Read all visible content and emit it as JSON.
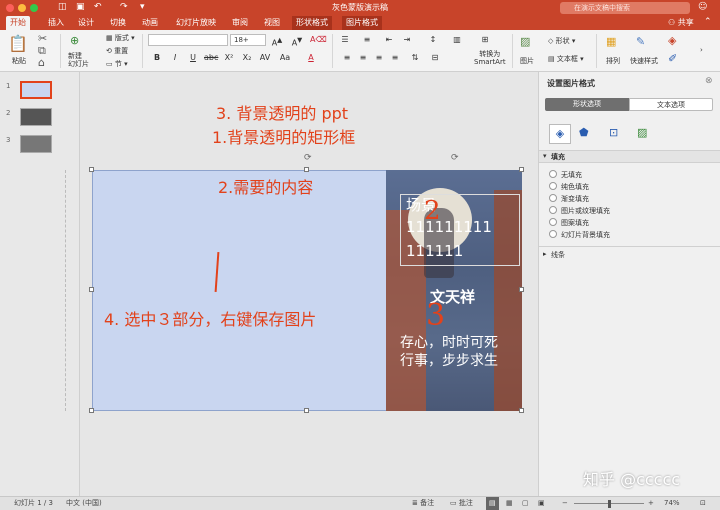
{
  "window": {
    "title": "灰色蒙版演示稿",
    "search_placeholder": "在演示文稿中搜索",
    "share_label": "共享"
  },
  "tabs": [
    "开始",
    "插入",
    "设计",
    "切换",
    "动画",
    "幻灯片放映",
    "审阅",
    "视图",
    "形状格式",
    "图片格式"
  ],
  "ribbon": {
    "paste": "粘贴",
    "new_slide": "新建\n幻灯片",
    "layout": "版式",
    "reset": "重置",
    "section": "节",
    "font_size": "18+",
    "convert": "转换为\nSmartArt",
    "picture": "图片",
    "shape": "形状",
    "textbox": "文本框",
    "arrange": "排列",
    "quick_styles": "快速样式"
  },
  "thumbnails": [
    "1",
    "2",
    "3"
  ],
  "slide": {
    "ann_title_1": "3. 背景透明的 ppt",
    "ann_title_2": "1.背景透明的矩形框",
    "ann_content": "2.需要的内容",
    "ann_step4": "4. 选中３部分，右键保存图片",
    "photo_scene": "场景",
    "photo_line1": "111111111",
    "photo_line2": "111111",
    "photo_name": "文天祥",
    "photo_quote1": "存心，时时可死",
    "photo_quote2": "行事，步步求生"
  },
  "panel": {
    "title": "设置图片格式",
    "tab_shape": "形状选项",
    "tab_text": "文本选项",
    "section_fill": "填充",
    "fill_options": [
      "无填充",
      "纯色填充",
      "渐变填充",
      "图片或纹理填充",
      "图案填充",
      "幻灯片背景填充"
    ],
    "section_line": "线条"
  },
  "status": {
    "slide_count": "幻灯片 1 / 3",
    "language": "中文 (中国)",
    "notes": "备注",
    "comments": "批注",
    "zoom": "74%"
  },
  "watermark": "知乎 @ccccc"
}
